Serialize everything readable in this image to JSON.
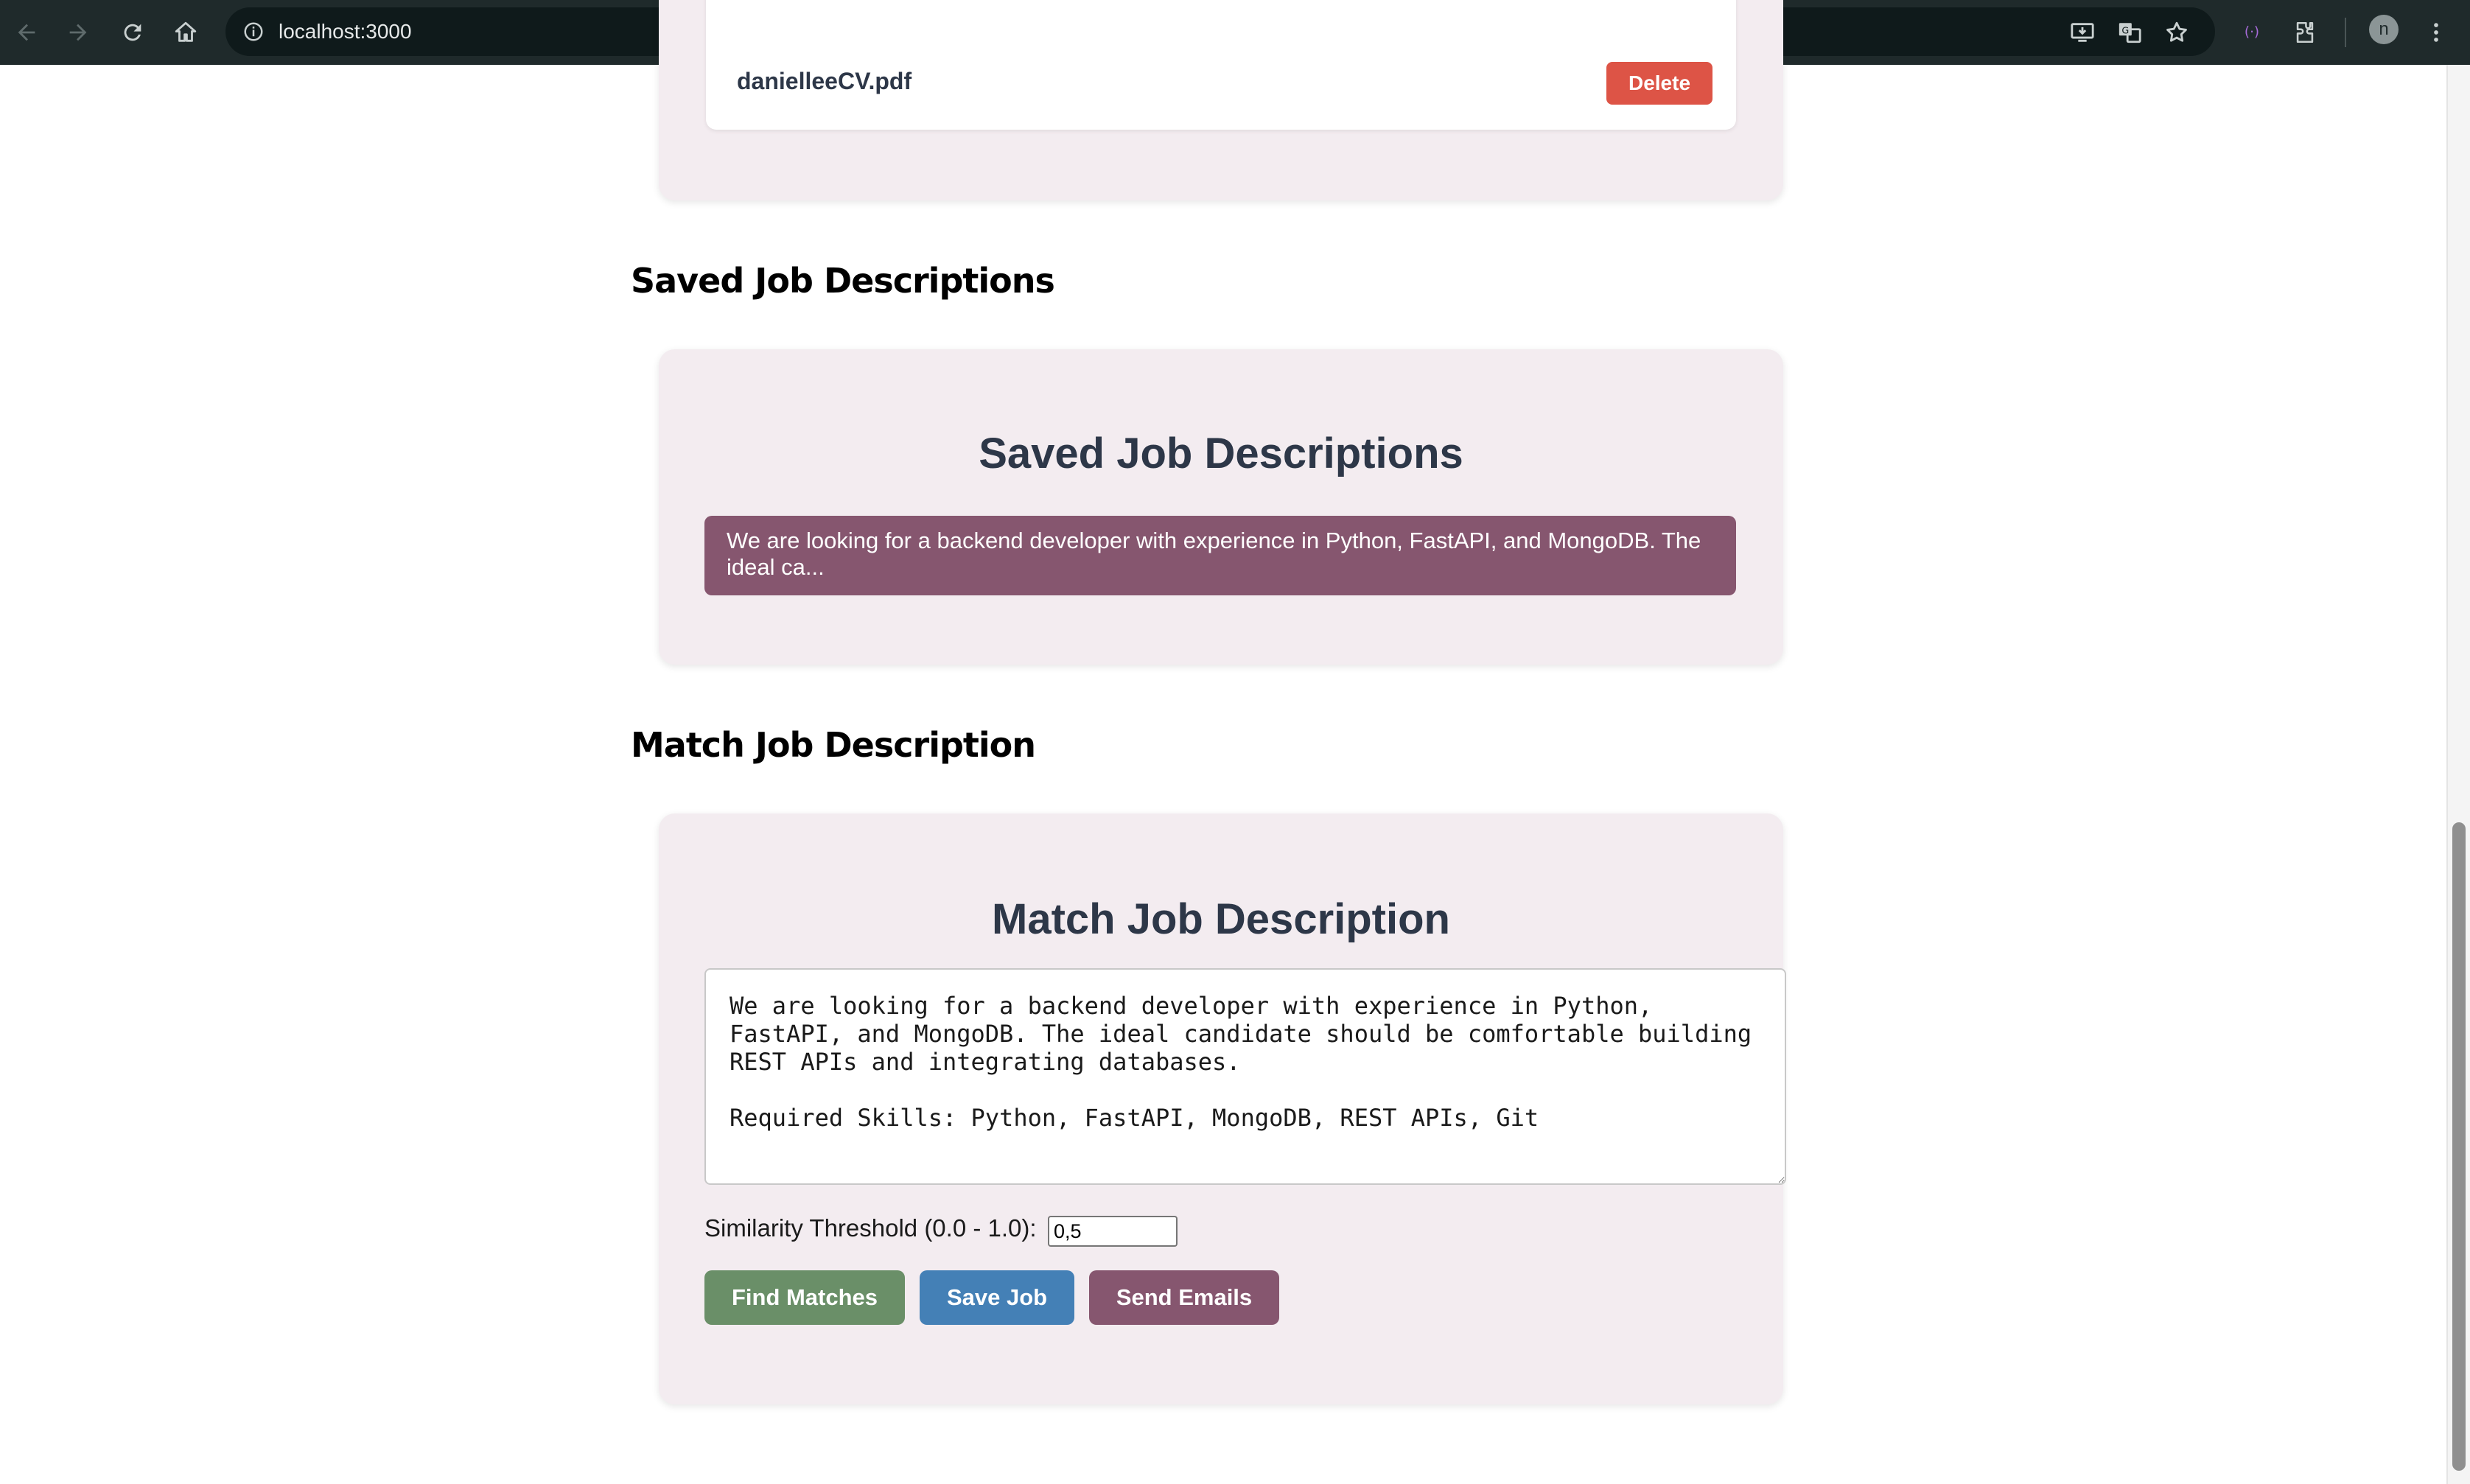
{
  "browser": {
    "url": "localhost:3000",
    "profile_initial": "n",
    "icons": [
      "back-icon",
      "forward-icon",
      "reload-icon",
      "home-icon",
      "site-info-icon",
      "install-app-icon",
      "translate-icon",
      "bookmark-star-icon",
      "extension-purple-icon",
      "extensions-puzzle-icon",
      "menu-kebab-icon"
    ]
  },
  "cv_section": {
    "file_name": "danielleeCV.pdf",
    "delete_label": "Delete"
  },
  "saved_jobs": {
    "section_heading": "Saved Job Descriptions",
    "card_title": "Saved Job Descriptions",
    "items": [
      {
        "preview": "We are looking for a backend developer with experience in Python, FastAPI, and MongoDB. The ideal ca..."
      }
    ]
  },
  "match": {
    "section_heading": "Match Job Description",
    "card_title": "Match Job Description",
    "job_text": "We are looking for a backend developer with experience in Python,\nFastAPI, and MongoDB. The ideal candidate should be comfortable building\nREST APIs and integrating databases.\n\nRequired Skills: Python, FastAPI, MongoDB, REST APIs, Git",
    "threshold_label": "Similarity Threshold (0.0 - 1.0):",
    "threshold_value": "0,5",
    "buttons": {
      "find": "Find Matches",
      "save": "Save Job",
      "send": "Send Emails"
    }
  },
  "colors": {
    "card_bg": "#f3ecf0",
    "heading_text": "#2d3748",
    "delete_red": "#dd5446",
    "plum": "#86566f",
    "green": "#6a8f68",
    "blue": "#4480b6",
    "chrome_bg": "#1f2a2b"
  }
}
